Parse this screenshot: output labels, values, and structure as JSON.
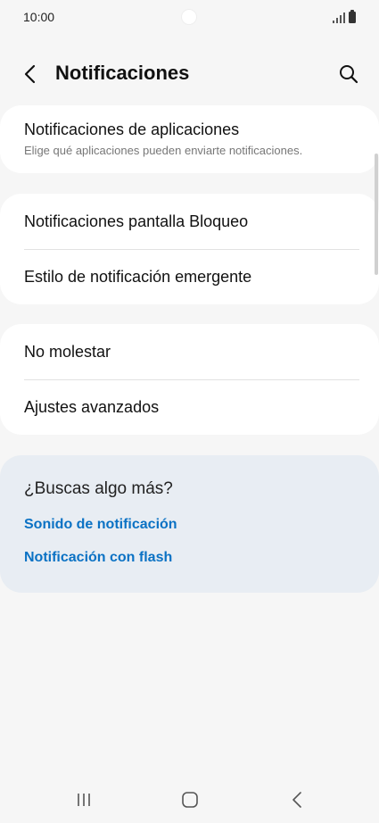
{
  "status_bar": {
    "time": "10:00"
  },
  "header": {
    "title": "Notificaciones"
  },
  "sections": [
    {
      "items": [
        {
          "title": "Notificaciones de aplicaciones",
          "subtitle": "Elige qué aplicaciones pueden enviarte notificaciones."
        }
      ]
    },
    {
      "items": [
        {
          "title": "Notificaciones pantalla Bloqueo"
        },
        {
          "title": "Estilo de notificación emergente"
        }
      ]
    },
    {
      "items": [
        {
          "title": "No molestar"
        },
        {
          "title": "Ajustes avanzados"
        }
      ]
    }
  ],
  "looking_for_more": {
    "title": "¿Buscas algo más?",
    "links": [
      "Sonido de notificación",
      "Notificación con flash"
    ]
  },
  "colors": {
    "background": "#f6f6f6",
    "card": "#ffffff",
    "suggestion_card": "#e8edf3",
    "link": "#0b72c4"
  },
  "icons": {
    "back": "chevron-left-icon",
    "search": "search-icon",
    "recents": "recents-icon",
    "home": "home-icon",
    "nav_back": "nav-back-icon"
  }
}
